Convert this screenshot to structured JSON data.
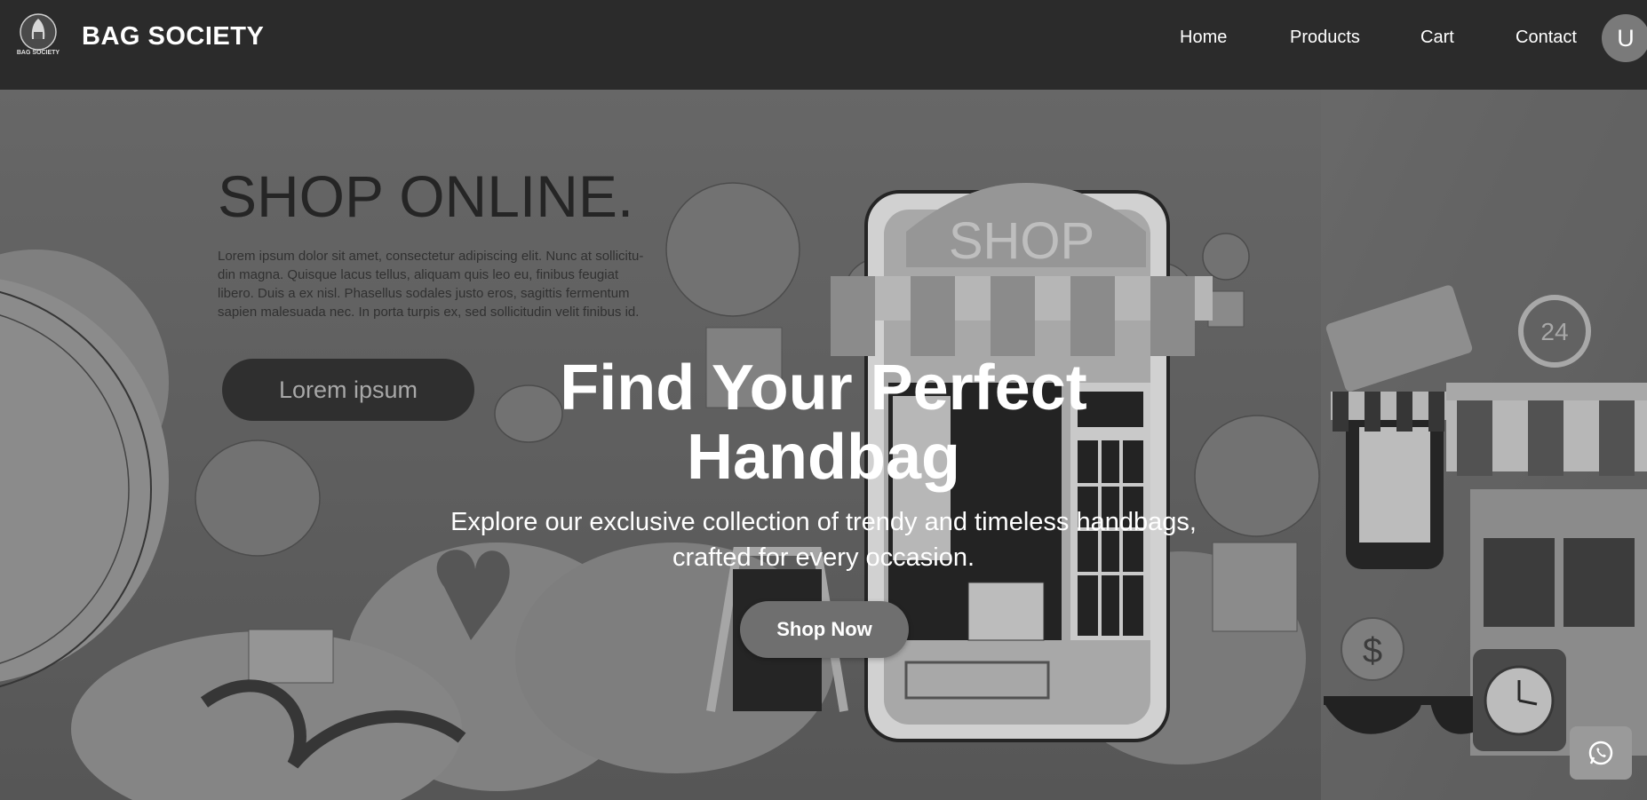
{
  "brand": {
    "name": "BAG SOCIETY",
    "logo_text": "BAG SOCIETY"
  },
  "nav": {
    "items": [
      {
        "label": "Home"
      },
      {
        "label": "Products"
      },
      {
        "label": "Cart"
      },
      {
        "label": "Contact"
      }
    ],
    "avatar_initial": "U"
  },
  "hero": {
    "title_line1": "Find Your Perfect",
    "title_line2": "Handbag",
    "subtitle_line1": "Explore our exclusive collection of trendy and timeless handbags,",
    "subtitle_line2": "crafted for every occasion.",
    "cta_label": "Shop Now",
    "banner": {
      "headline": "SHOP ONLINE.",
      "body_lines": [
        "Lorem ipsum dolor sit amet, consectetur adipiscing elit. Nunc at sollicitu-",
        "din magna. Quisque lacus tellus, aliquam quis leo eu, finibus feugiat",
        "libero. Duis a ex nisl. Phasellus sodales justo eros, sagittis fermentum",
        "sapien malesuada nec. In porta turpis ex, sed sollicitudin velit finibus id."
      ],
      "button_label": "Lorem ipsum",
      "shop_sign": "SHOP",
      "clock_label": "24"
    }
  },
  "floating": {
    "whatsapp_icon": "whatsapp-icon"
  },
  "colors": {
    "navbar": "#2b2b2b",
    "hero_base": "#6a6a6a",
    "text": "#ffffff",
    "cta": "#6f6f6f"
  }
}
